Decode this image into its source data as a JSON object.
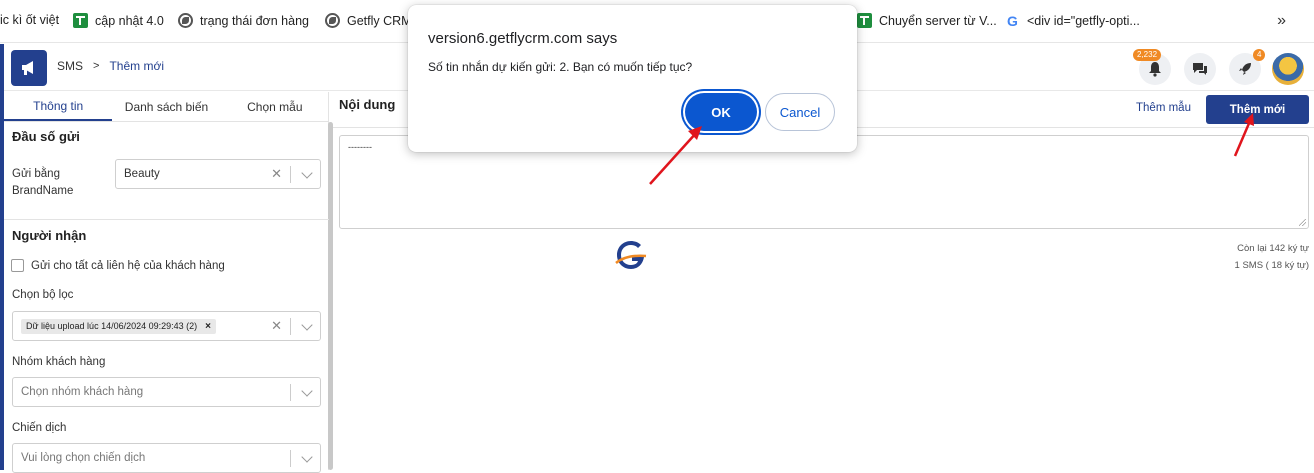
{
  "bookmarks": [
    {
      "label": "ic kì ốt việt",
      "icon": "none"
    },
    {
      "label": "cập nhật 4.0",
      "icon": "sheets-icon"
    },
    {
      "label": "trạng thái đơn hàng",
      "icon": "globe-icon"
    },
    {
      "label": "Getfly CRM",
      "icon": "globe-icon"
    },
    {
      "label": "Chuyển server từ V...",
      "icon": "sheets-icon"
    },
    {
      "label": "<div id=\"getfly-opti...",
      "icon": "google-icon"
    }
  ],
  "bookmarks_more": "»",
  "header": {
    "breadcrumb_root": "SMS",
    "breadcrumb_separator": ">",
    "breadcrumb_current": "Thêm mới",
    "notification_count": "2,232",
    "rocket_badge": "4"
  },
  "left": {
    "tabs": [
      "Thông tin",
      "Danh sách biến",
      "Chọn mẫu"
    ],
    "sender": {
      "title": "Đầu số gửi",
      "label_line1": "Gửi bằng",
      "label_line2": "BrandName",
      "value": "Beauty"
    },
    "recipients": {
      "title": "Người nhận",
      "send_all_label": "Gửi cho tất cả liên hệ của khách hàng",
      "filter_label": "Chọn bộ lọc",
      "filter_chip": "Dữ liệu upload lúc 14/06/2024 09:29:43 (2)",
      "group_label": "Nhóm khách hàng",
      "group_placeholder": "Chọn nhóm khách hàng",
      "campaign_label": "Chiến dịch",
      "campaign_placeholder": "Vui lòng chọn chiến dịch"
    }
  },
  "content": {
    "title": "Nội dung",
    "add_template": "Thêm mẫu",
    "add_new": "Thêm mới",
    "message_text": "--------",
    "remaining": "Còn lại 142 ký tự",
    "sms_count": "1 SMS ( 18 ký tự)"
  },
  "dialog": {
    "title": "version6.getflycrm.com says",
    "message": "Số tin nhắn dự kiến gửi: 2. Bạn có muốn tiếp tục?",
    "ok": "OK",
    "cancel": "Cancel"
  },
  "colors": {
    "brand": "#23408e",
    "dialog_ok": "#0b57d0",
    "badge": "#f08a24",
    "annotation_arrow": "#e0151d"
  }
}
